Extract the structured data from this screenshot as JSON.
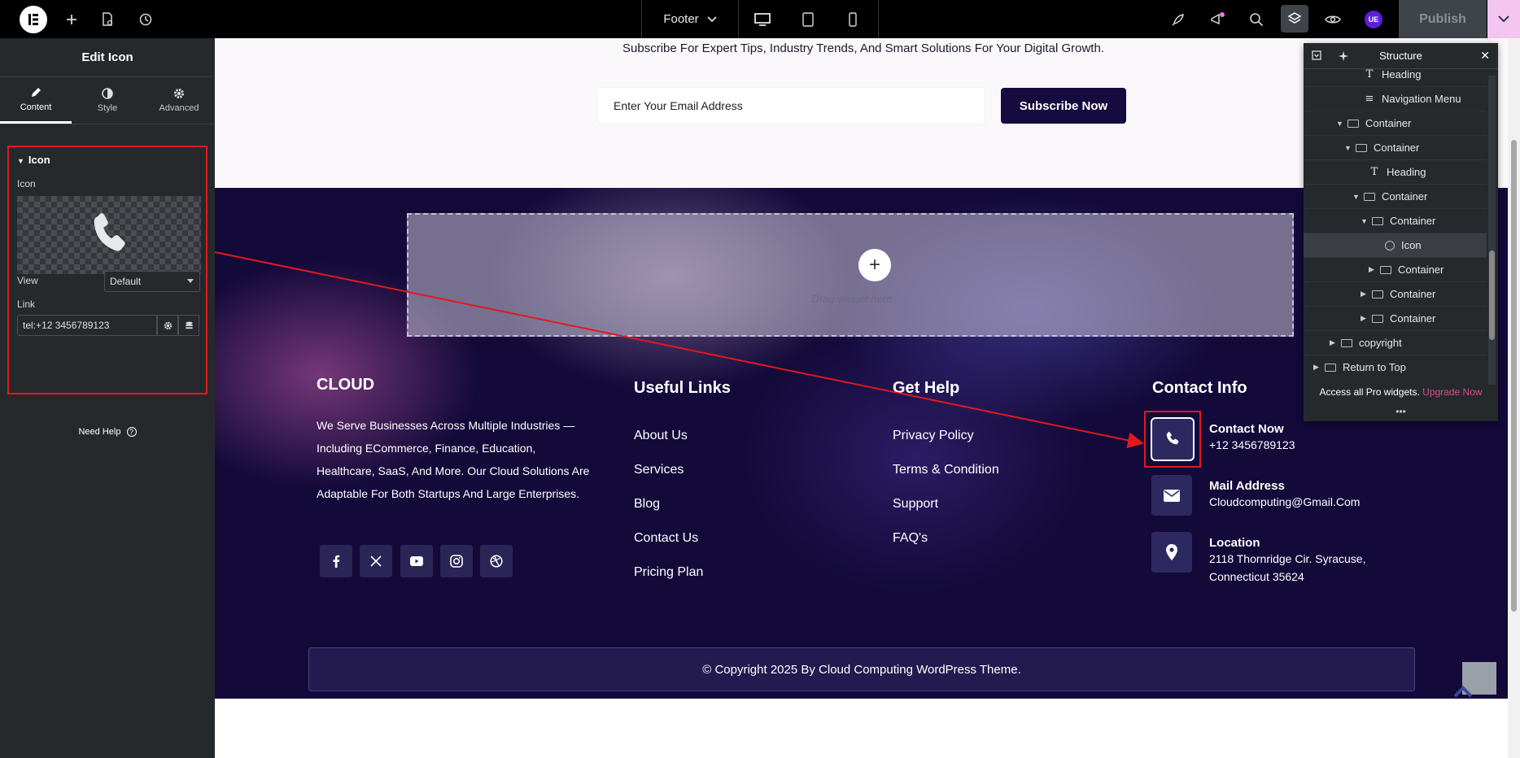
{
  "topbar": {
    "document": "Footer",
    "publish_label": "Publish",
    "avatar_initials": "UE"
  },
  "panel": {
    "title": "Edit Icon",
    "tabs": [
      {
        "label": "Content",
        "icon": "pencil-icon",
        "active": true
      },
      {
        "label": "Style",
        "icon": "half-circle-icon",
        "active": false
      },
      {
        "label": "Advanced",
        "icon": "gear-icon",
        "active": false
      }
    ],
    "section_title": "Icon",
    "icon_label": "Icon",
    "view_label": "View",
    "view_value": "Default",
    "link_label": "Link",
    "link_value": "tel:+12 3456789123",
    "need_help": "Need Help"
  },
  "canvas": {
    "subscribe_text": "Subscribe For Expert Tips, Industry Trends, And Smart Solutions For Your Digital Growth.",
    "email_placeholder": "Enter Your Email Address",
    "subscribe_button": "Subscribe Now",
    "drop_text": "Drag widget here",
    "drop_plus": "+"
  },
  "footer": {
    "brand": "CLOUD",
    "about": "We Serve Businesses Across Multiple Industries — Including ECommerce, Finance, Education, Healthcare, SaaS, And More. Our Cloud Solutions Are Adaptable For Both Startups And Large Enterprises.",
    "useful_links_title": "Useful Links",
    "useful_links": [
      "About Us",
      "Services",
      "Blog",
      "Contact Us",
      "Pricing Plan"
    ],
    "get_help_title": "Get Help",
    "get_help": [
      "Privacy Policy",
      "Terms & Condition",
      "Support",
      "FAQ's"
    ],
    "contact_title": "Contact Info",
    "contact": [
      {
        "title": "Contact Now",
        "value": "+12 3456789123",
        "icon": "phone-icon"
      },
      {
        "title": "Mail Address",
        "value": "Cloudcomputing@Gmail.Com",
        "icon": "envelope-icon"
      },
      {
        "title": "Location",
        "value_line1": "2118 Thornridge Cir. Syracuse,",
        "value_line2": "Connecticut 35624",
        "icon": "map-pin-icon"
      }
    ],
    "social": [
      "facebook-icon",
      "x-twitter-icon",
      "youtube-icon",
      "instagram-icon",
      "dribbble-icon"
    ],
    "copyright": "© Copyright 2025 By Cloud Computing WordPress Theme."
  },
  "structure": {
    "title": "Structure",
    "rows": [
      {
        "label": "Heading"
      },
      {
        "label": "Navigation Menu"
      },
      {
        "label": "Container"
      },
      {
        "label": "Container"
      },
      {
        "label": "Heading"
      },
      {
        "label": "Container"
      },
      {
        "label": "Container"
      },
      {
        "label": "Icon"
      },
      {
        "label": "Container"
      },
      {
        "label": "Container"
      },
      {
        "label": "Container"
      },
      {
        "label": "copyright"
      },
      {
        "label": "Return to Top"
      }
    ],
    "footer_text": "Access all Pro widgets.",
    "upgrade": "Upgrade Now",
    "dots": "•••"
  },
  "colors": {
    "accent_red": "#e0191c",
    "footer_bg": "#130a3a",
    "panel_bg": "#26292c",
    "upgrade_pink": "#e2498a"
  }
}
